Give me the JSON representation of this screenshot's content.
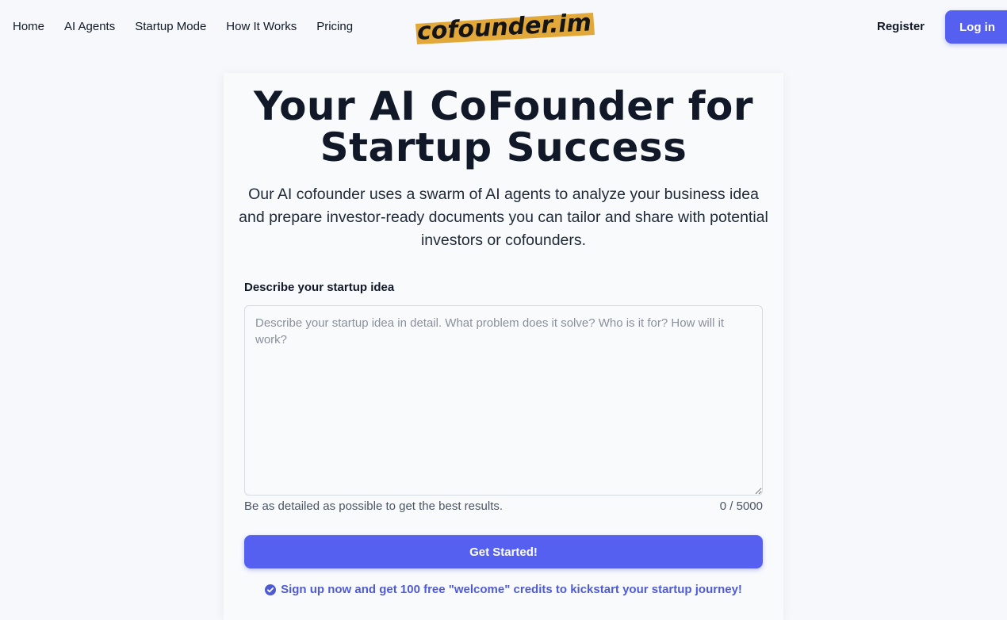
{
  "nav": {
    "items": [
      {
        "label": "Home"
      },
      {
        "label": "AI Agents"
      },
      {
        "label": "Startup Mode"
      },
      {
        "label": "How It Works"
      },
      {
        "label": "Pricing"
      }
    ],
    "register_label": "Register",
    "login_label": "Log in"
  },
  "logo": {
    "text": "cofounder.im"
  },
  "hero": {
    "title_line1": "Your AI CoFounder for",
    "title_line2": "Startup Success",
    "subtitle": "Our AI cofounder uses a swarm of AI agents to analyze your business idea and prepare investor-ready documents you can tailor and share with potential investors or cofounders."
  },
  "form": {
    "label": "Describe your startup idea",
    "placeholder": "Describe your startup idea in detail. What problem does it solve? Who is it for? How will it work?",
    "value": "",
    "hint": "Be as detailed as possible to get the best results.",
    "counter": "0 / 5000",
    "submit_label": "Get Started!"
  },
  "promo": {
    "text": "Sign up now and get 100 free \"welcome\" credits to kickstart your startup journey!"
  },
  "colors": {
    "accent": "#5560f0",
    "promo_text": "#4f5bd5",
    "logo_bg": "#e2a83a",
    "background": "#f6f8fb"
  },
  "icons": {
    "promo_icon": "check-circle-icon",
    "textarea_resize": "resize-handle-icon"
  }
}
